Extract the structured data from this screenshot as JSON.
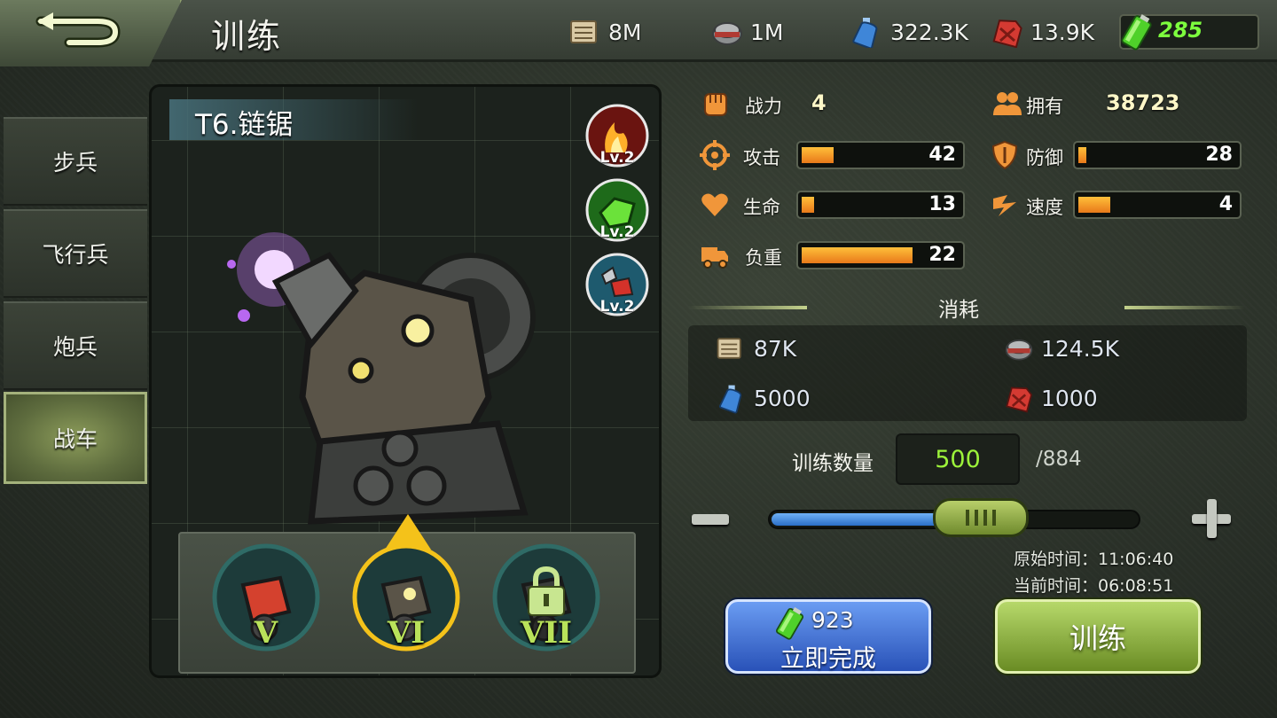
{
  "header": {
    "title": "训练",
    "resources": [
      {
        "icon": "supplies-icon",
        "value": "8M"
      },
      {
        "icon": "canned-food-icon",
        "value": "1M"
      },
      {
        "icon": "water-bottle-icon",
        "value": "322.3K"
      },
      {
        "icon": "fuel-can-icon",
        "value": "13.9K"
      }
    ],
    "energy": {
      "icon": "energy-battery-icon",
      "value": "285"
    }
  },
  "tabs": [
    {
      "label": "步兵",
      "active": false
    },
    {
      "label": "飞行兵",
      "active": false
    },
    {
      "label": "炮兵",
      "active": false
    },
    {
      "label": "战车",
      "active": true
    }
  ],
  "unit": {
    "name": "T6.链锯",
    "skills": [
      {
        "icon": "fire-skill-icon",
        "level": "Lv.2"
      },
      {
        "icon": "repair-skill-icon",
        "level": "Lv.2"
      },
      {
        "icon": "chainsaw-skill-icon",
        "level": "Lv.2"
      }
    ],
    "tiers": [
      {
        "label": "V",
        "state": "unlocked"
      },
      {
        "label": "VI",
        "state": "selected"
      },
      {
        "label": "VII",
        "state": "locked"
      }
    ]
  },
  "stats": {
    "power_label": "战力",
    "power_value": "4",
    "owned_label": "拥有",
    "owned_value": "38723",
    "attack": {
      "label": "攻击",
      "value": "42",
      "fill": 0.2
    },
    "defense": {
      "label": "防御",
      "value": "28",
      "fill": 0.05
    },
    "health": {
      "label": "生命",
      "value": "13",
      "fill": 0.08
    },
    "speed": {
      "label": "速度",
      "value": "4",
      "fill": 0.2
    },
    "load": {
      "label": "负重",
      "value": "22",
      "fill": 0.7
    }
  },
  "consumption": {
    "title": "消耗",
    "supplies": "87K",
    "food": "124.5K",
    "water": "5000",
    "fuel": "1000"
  },
  "quantity": {
    "label": "训练数量",
    "value": "500",
    "max": "/884",
    "fraction": 0.565
  },
  "times": {
    "original": "原始时间：11:06:40",
    "current": "当前时间：06:08:51"
  },
  "buttons": {
    "instant_cost": "923",
    "instant_label": "立即完成",
    "train_label": "训练"
  },
  "colors": {
    "bar_fill": "#f09a24",
    "quantity_text": "#9cf23a",
    "energy_text": "#7dff3e",
    "tier_label": "#b9e25a"
  }
}
